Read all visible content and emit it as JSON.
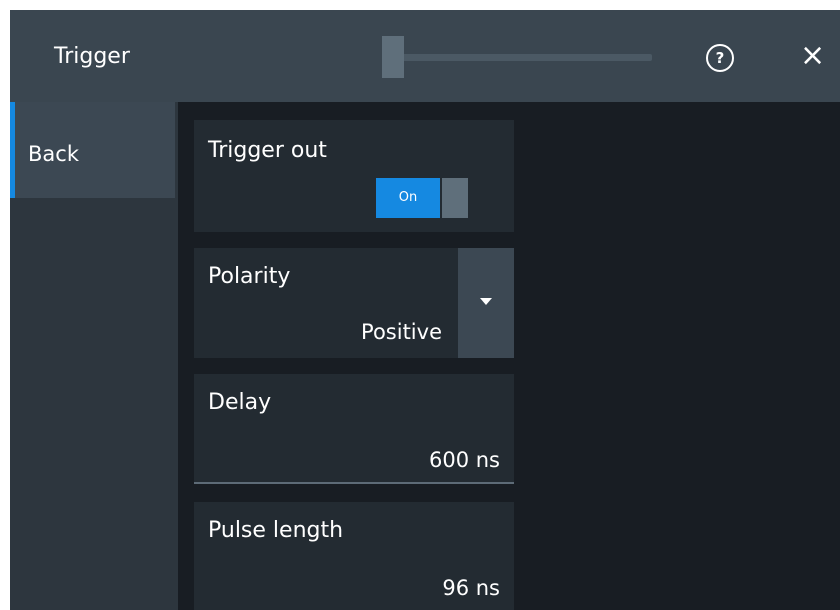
{
  "dialog": {
    "title": "Trigger",
    "help_symbol": "?",
    "close_symbol": "×"
  },
  "sidebar": {
    "back_label": "Back"
  },
  "settings": {
    "trigger_out": {
      "label": "Trigger out",
      "state": "On"
    },
    "polarity": {
      "label": "Polarity",
      "value": "Positive"
    },
    "delay": {
      "label": "Delay",
      "value": "600 ns"
    },
    "pulse_length": {
      "label": "Pulse length",
      "value": "96 ns"
    }
  },
  "colors": {
    "accent": "#1589e1",
    "background": "#181d23",
    "panel": "#232b32",
    "titlebar": "#3a4650"
  },
  "icons": [
    "help-icon",
    "close-icon",
    "dropdown-arrow-icon"
  ]
}
